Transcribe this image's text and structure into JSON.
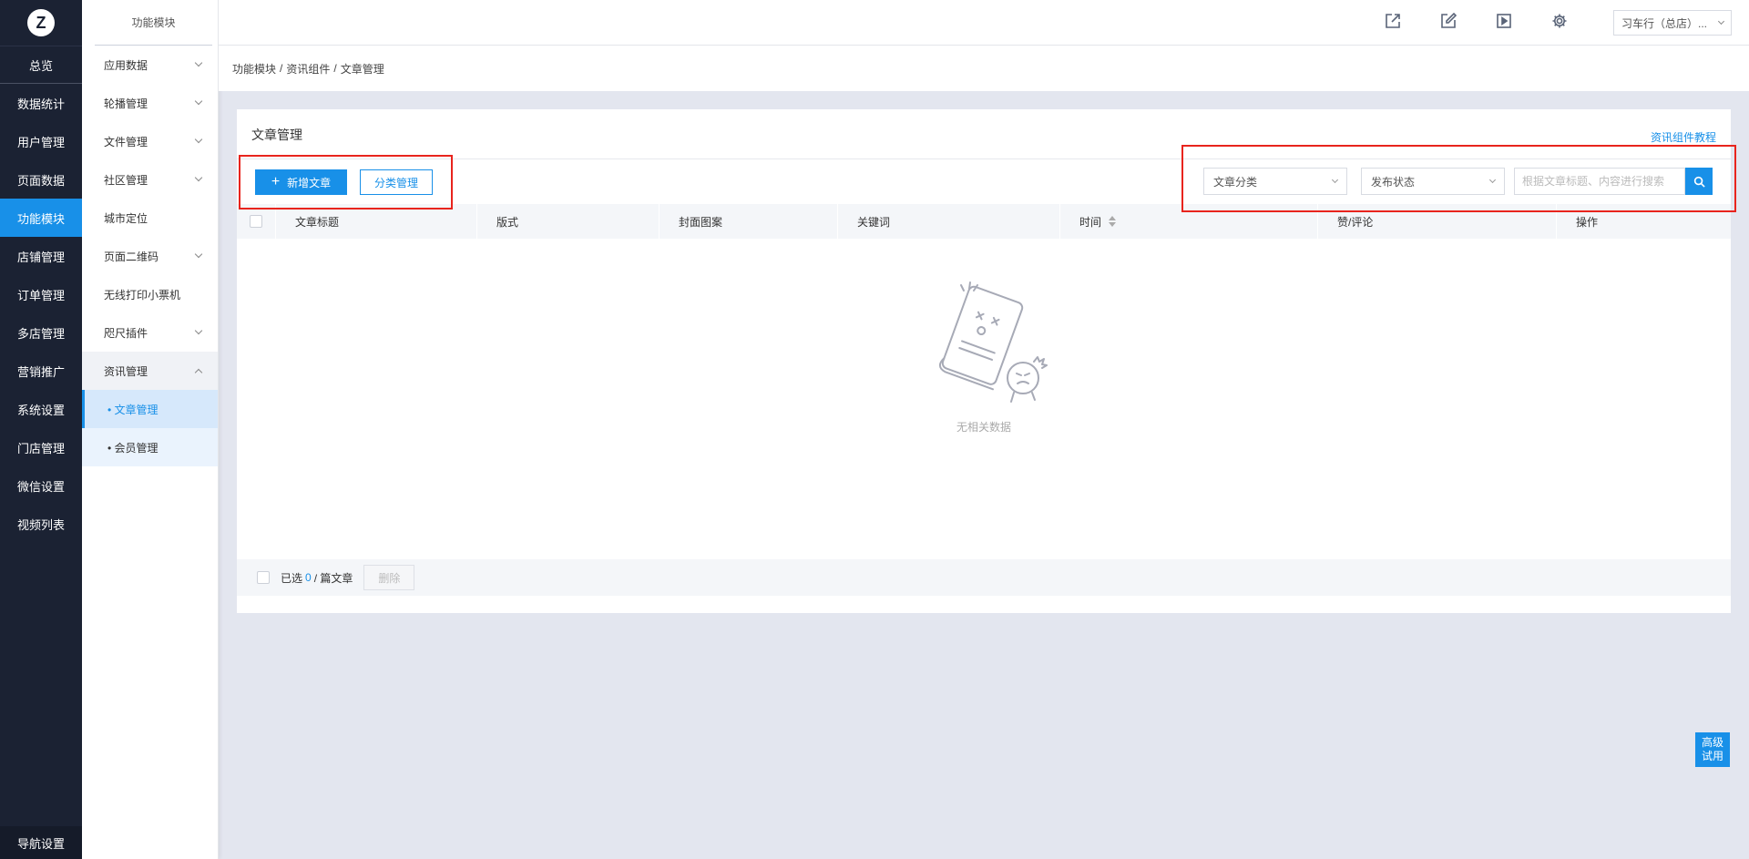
{
  "app": {
    "logo_letter": "Z",
    "home": "总览",
    "bottom_nav": "导航设置"
  },
  "main_nav": [
    {
      "label": "数据统计"
    },
    {
      "label": "用户管理"
    },
    {
      "label": "页面数据"
    },
    {
      "label": "功能模块"
    },
    {
      "label": "店铺管理"
    },
    {
      "label": "订单管理"
    },
    {
      "label": "多店管理"
    },
    {
      "label": "营销推广"
    },
    {
      "label": "系统设置"
    },
    {
      "label": "门店管理"
    },
    {
      "label": "微信设置"
    },
    {
      "label": "视频列表"
    }
  ],
  "sub_nav": {
    "title": "功能模块",
    "items": [
      {
        "label": "应用数据"
      },
      {
        "label": "轮播管理"
      },
      {
        "label": "文件管理"
      },
      {
        "label": "社区管理"
      },
      {
        "label": "城市定位"
      },
      {
        "label": "页面二维码"
      },
      {
        "label": "无线打印小票机"
      },
      {
        "label": "咫尺插件"
      },
      {
        "label": "资讯管理"
      }
    ],
    "children": [
      {
        "label": "• 文章管理"
      },
      {
        "label": "• 会员管理"
      }
    ]
  },
  "header": {
    "store_label": "习车行（总店）..."
  },
  "breadcrumb": [
    "功能模块",
    "/",
    "资讯组件",
    "/",
    "文章管理"
  ],
  "card": {
    "title": "文章管理",
    "help_link": "资讯组件教程",
    "add_button": "新增文章",
    "category_button": "分类管理",
    "filter_category": "文章分类",
    "filter_status": "发布状态",
    "search_placeholder": "根据文章标题、内容进行搜索"
  },
  "table": {
    "columns": [
      "文章标题",
      "版式",
      "封面图案",
      "关键词",
      "时间",
      "赞/评论",
      "操作"
    ],
    "empty_text": "无相关数据"
  },
  "footer": {
    "selected_prefix": "已选",
    "selected_count": "0",
    "selected_suffix": "/ 篇文章",
    "delete_button": "删除"
  },
  "float_button": {
    "line1": "高级",
    "line2": "试用"
  },
  "colors": {
    "accent": "#1890e8",
    "nav_bg": "#1b2233",
    "highlight": "#e8241d"
  }
}
